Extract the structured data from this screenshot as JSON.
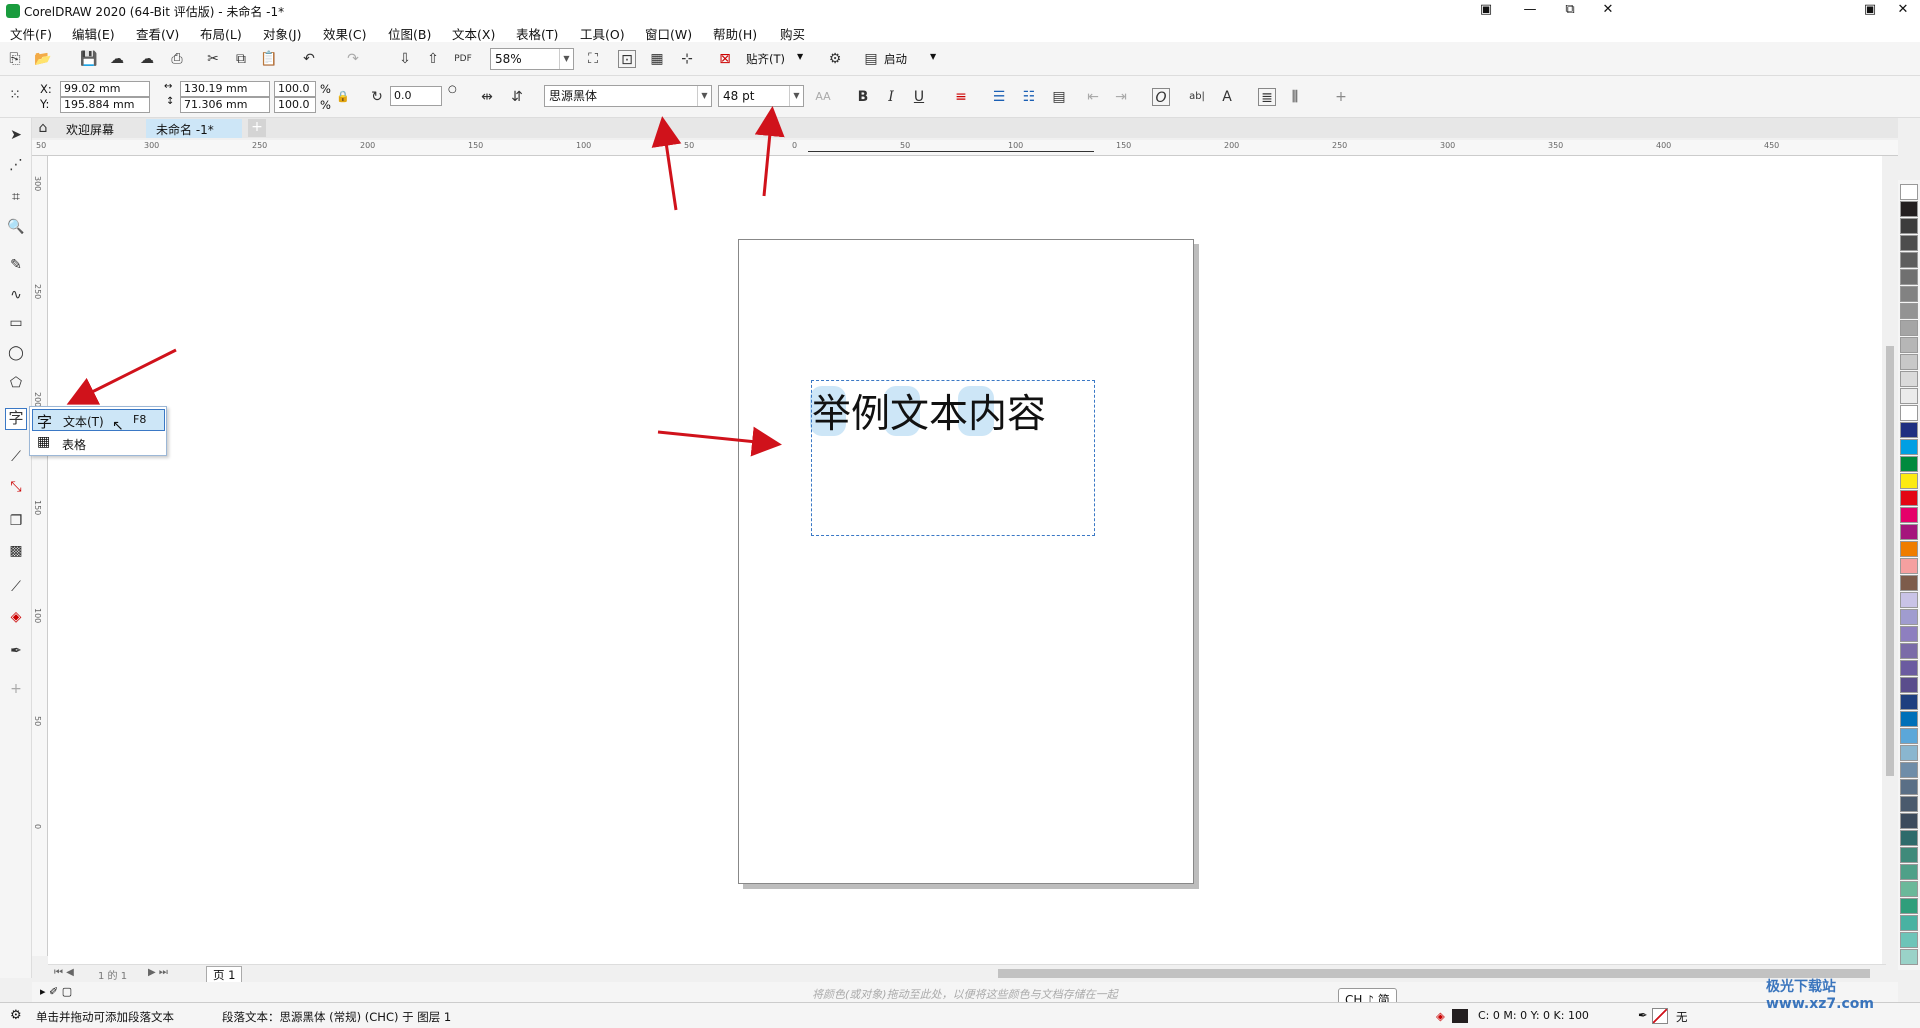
{
  "window": {
    "title": "CorelDRAW 2020 (64-Bit 评估版) - 未命名 -1*",
    "minimize": "—",
    "maximize": "⧉",
    "close": "✕",
    "help": "▣"
  },
  "menus": [
    "文件(F)",
    "编辑(E)",
    "查看(V)",
    "布局(L)",
    "对象(J)",
    "效果(C)",
    "位图(B)",
    "文本(X)",
    "表格(T)",
    "工具(O)",
    "窗口(W)",
    "帮助(H)",
    "购买"
  ],
  "toolbar": {
    "zoom": "58%",
    "snap_label": "贴齐(T)",
    "launch_label": "启动"
  },
  "props": {
    "x_label": "X:",
    "x": "99.02 mm",
    "y_label": "Y:",
    "y": "195.884 mm",
    "w": "130.19 mm",
    "h": "71.306 mm",
    "sx": "100.0",
    "sy": "100.0",
    "pct": "%",
    "angle": "0.0",
    "font": "思源黑体",
    "size": "48 pt"
  },
  "doc_tabs": [
    "欢迎屏幕",
    "未命名 -1*"
  ],
  "ruler_h": [
    "50",
    "300",
    "250",
    "200",
    "150",
    "100",
    "50",
    "0",
    "50",
    "100",
    "150",
    "200",
    "250",
    "300",
    "350",
    "400",
    "450"
  ],
  "ruler_v": [
    "300",
    "250",
    "200",
    "150",
    "100",
    "50",
    "0"
  ],
  "canvas": {
    "sample_text": "举例文本内容"
  },
  "flyout": {
    "items": [
      {
        "icon": "字",
        "label": "文本(T)",
        "shortcut": "F8"
      },
      {
        "icon": "▦",
        "label": "表格",
        "shortcut": ""
      }
    ]
  },
  "palette": [
    "#ffffff",
    "#231f20",
    "#3d3d3d",
    "#4d4d4d",
    "#5e5e5e",
    "#707070",
    "#828282",
    "#939393",
    "#a5a5a5",
    "#b6b6b6",
    "#c8c8c8",
    "#dadada",
    "#ebebeb",
    "#ffffff",
    "#1f2f80",
    "#009fe3",
    "#008a3e",
    "#fcea10",
    "#e30613",
    "#e5006a",
    "#a5157c",
    "#ef7d00",
    "#f5a0a0",
    "#7d5c4b",
    "#c9c3e6",
    "#a09ccf",
    "#8e7fbf",
    "#7a6ba8",
    "#6b5ba0",
    "#5a4d8c",
    "#1e3f7f",
    "#0070b8",
    "#5ba7d9",
    "#8ab6cf",
    "#6f8da8",
    "#5a6f86",
    "#4a5a6d",
    "#3c4b5c",
    "#2e6b6b",
    "#3f8a7a",
    "#4fa088",
    "#6bb89a",
    "#2f9e7b",
    "#48b2a2",
    "#6dc4b8",
    "#9ad2c8"
  ],
  "page_nav": {
    "info": "1 的 1",
    "page_tab": "页 1"
  },
  "hint": "将颜色(或对象)拖动至此处，以便将这些颜色与文档存储在一起",
  "ime": "CH ♪ 简",
  "status": {
    "left": "单击并拖动可添加段落文本",
    "info": "段落文本：思源黑体 (常规) (CHC) 于 图层 1",
    "cmyk": "C: 0 M: 0 Y: 0 K: 100",
    "outline": "无"
  },
  "watermark": "极光下载站 www.xz7.com"
}
